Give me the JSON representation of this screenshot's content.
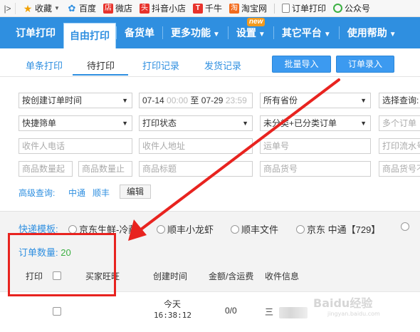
{
  "bookmarks": {
    "side_icon": "|>",
    "items": [
      {
        "icon": "star-icon",
        "label": "收藏",
        "has_menu": true,
        "color": "#f0a000"
      },
      {
        "icon": "baidu-paw-icon",
        "label": "百度",
        "color": "#2f8fe0"
      },
      {
        "icon": "weidian-icon",
        "icon_text": "店",
        "label": "微店",
        "color": "#e8332c"
      },
      {
        "icon": "toutiao-icon",
        "icon_text": "头",
        "label": "抖音小店",
        "color": "#e8332c"
      },
      {
        "icon": "qianniu-icon",
        "icon_text": "T",
        "label": "千牛",
        "color": "#e8332c"
      },
      {
        "icon": "taobao-icon",
        "icon_text": "淘",
        "label": "淘宝网",
        "color": "#f36b1c"
      },
      {
        "icon": "page-icon",
        "label": "订单打印",
        "color": "#888888"
      },
      {
        "icon": "wechat-mp-icon",
        "label": "公众号",
        "color": "#3cb043"
      }
    ]
  },
  "nav": {
    "items": [
      {
        "label": "订单打印",
        "active": false
      },
      {
        "label": "自由打印",
        "active": true
      },
      {
        "label": "备货单",
        "active": false
      },
      {
        "label": "更多功能",
        "caret": true
      },
      {
        "label": "设置",
        "caret": true,
        "badge": "new"
      },
      {
        "label": "其它平台",
        "caret": true
      },
      {
        "label": "使用帮助",
        "caret": true
      }
    ]
  },
  "subtabs": {
    "items": [
      "单条打印",
      "待打印",
      "打印记录",
      "发货记录"
    ],
    "active_index": 1,
    "import_button": "批量导入",
    "entry_button": "订单录入"
  },
  "filters": {
    "time_type": "按创建订单时间",
    "date_from": "07-14",
    "time_from": "00:00",
    "date_separator": "至",
    "date_to": "07-29",
    "time_to": "23:59",
    "province": "所有省份",
    "query_label": "选择查询:",
    "quick_filter": "快捷筛单",
    "print_status": "打印状态",
    "category": "未分类+已分类订单",
    "multi_order_placeholder": "多个订单",
    "receiver_phone_placeholder": "收件人电话",
    "receiver_address_placeholder": "收件人地址",
    "waybill_placeholder": "运单号",
    "print_serial_placeholder": "打印流水号",
    "qty_from_placeholder": "商品数量起",
    "qty_to_placeholder": "商品数量止",
    "goods_title_placeholder": "商品标题",
    "goods_code_placeholder": "商品货号",
    "goods_code2_placeholder": "商品货号不",
    "advanced_label": "高级查询:",
    "advanced_links": [
      "中通",
      "顺丰"
    ],
    "edit_button": "编辑"
  },
  "templates": {
    "label": "快递模板:",
    "options": [
      "京东生鲜-冷藏",
      "顺丰小龙虾",
      "顺丰文件",
      "京东 中通【729】",
      ""
    ]
  },
  "orders": {
    "count_label": "订单数量:",
    "count": "20",
    "headers": {
      "print": "打印",
      "buyer": "买家旺旺",
      "created": "创建时间",
      "amount": "金额/含运费",
      "receiver": "收件信息"
    },
    "rows": [
      {
        "created_day": "今天",
        "created_time": "16:38:12",
        "amount": "0/0",
        "receiver_initial": "三"
      }
    ]
  },
  "watermark": {
    "text": "Baidu经验",
    "sub": "jingyan.baidu.com"
  },
  "colors": {
    "brand_blue": "#2f8fe0",
    "annotation_red": "#e8231f",
    "count_green": "#3cb043"
  }
}
